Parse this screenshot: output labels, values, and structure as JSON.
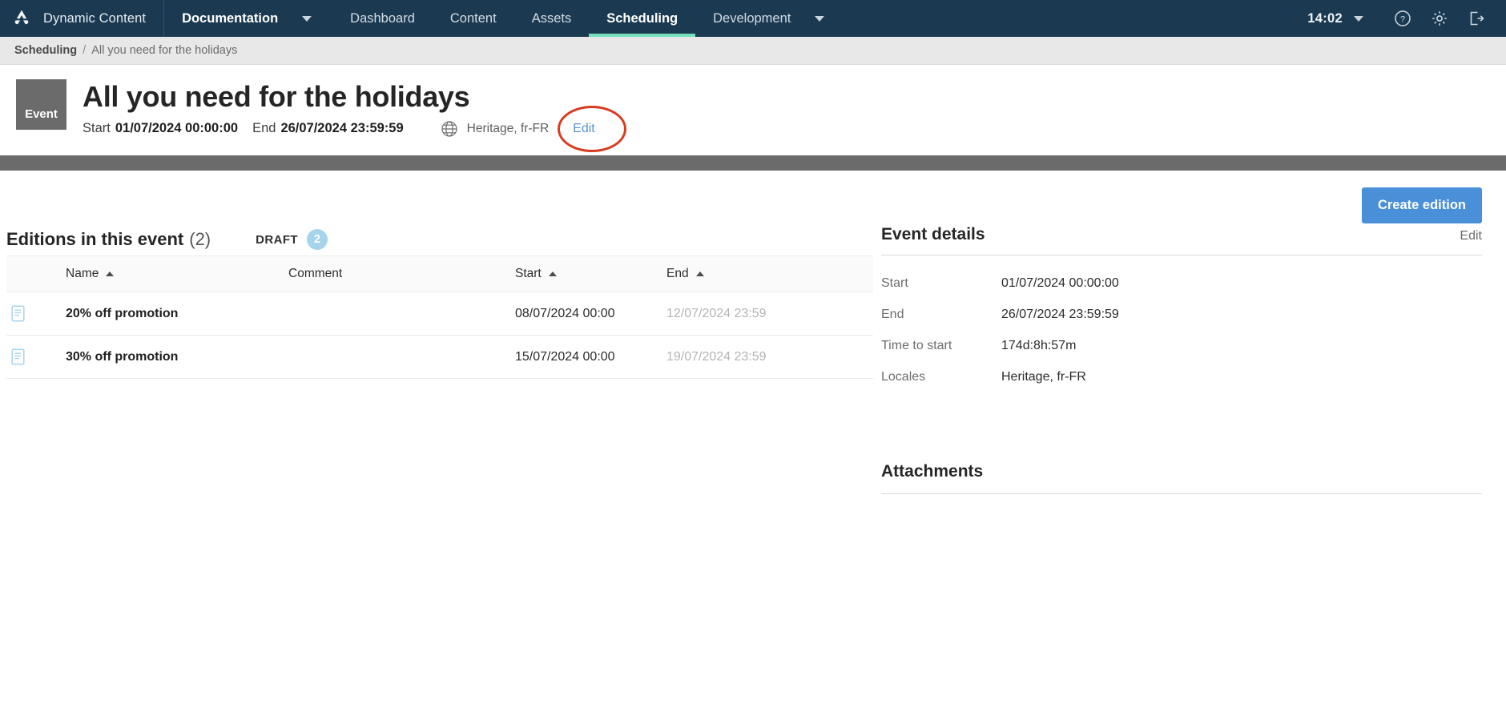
{
  "topnav": {
    "logo_icon": "amplience-logo-icon",
    "brand": "Dynamic Content",
    "items": [
      {
        "label": "Documentation",
        "icon": "chevron-down-icon",
        "has_caret": true,
        "bold": true,
        "active": false
      },
      {
        "label": "Dashboard",
        "has_caret": false,
        "bold": false,
        "active": false
      },
      {
        "label": "Content",
        "has_caret": false,
        "bold": false,
        "active": false
      },
      {
        "label": "Assets",
        "has_caret": false,
        "bold": false,
        "active": false
      },
      {
        "label": "Scheduling",
        "has_caret": false,
        "bold": true,
        "active": true
      },
      {
        "label": "Development",
        "icon": "chevron-down-icon",
        "has_caret": true,
        "bold": false,
        "active": false
      }
    ],
    "clock": "14:02",
    "clock_caret_icon": "chevron-down-icon",
    "help_icon": "help-circle-icon",
    "settings_icon": "gear-icon",
    "logout_icon": "logout-icon",
    "bg_color": "#1b3a52",
    "active_underline_color": "#76e0bd"
  },
  "breadcrumb": {
    "root": "Scheduling",
    "separator": "/",
    "current": "All you need for the holidays"
  },
  "header": {
    "badge": "Event",
    "title": "All you need for the holidays",
    "start_label": "Start",
    "start_value": "01/07/2024 00:00:00",
    "end_label": "End",
    "end_value": "26/07/2024 23:59:59",
    "globe_icon": "globe-icon",
    "locales": "Heritage, fr-FR",
    "edit_label": "Edit",
    "edit_link_color": "#5794d0",
    "annotation_color": "#d83b1e"
  },
  "toolbar": {
    "create_edition_label": "Create edition",
    "primary_color": "#4a90d9"
  },
  "editions": {
    "title": "Editions in this event",
    "count": "(2)",
    "status_label": "DRAFT",
    "status_count": "2",
    "status_pill_color": "#a6d4ec",
    "columns": [
      {
        "label": "",
        "sortable": false
      },
      {
        "label": "Name",
        "sortable": true,
        "sort_icon": "sort-ascending-icon"
      },
      {
        "label": "Comment",
        "sortable": false
      },
      {
        "label": "Start",
        "sortable": true,
        "sort_icon": "sort-ascending-icon"
      },
      {
        "label": "End",
        "sortable": true,
        "sort_icon": "sort-ascending-icon"
      }
    ],
    "rows": [
      {
        "icon": "edition-document-icon",
        "name": "20% off promotion",
        "comment": "",
        "start": "08/07/2024 00:00",
        "end": "12/07/2024 23:59"
      },
      {
        "icon": "edition-document-icon",
        "name": "30% off promotion",
        "comment": "",
        "start": "15/07/2024 00:00",
        "end": "19/07/2024 23:59"
      }
    ]
  },
  "event_details": {
    "title": "Event details",
    "edit_label": "Edit",
    "rows": [
      {
        "key": "Start",
        "value": "01/07/2024 00:00:00"
      },
      {
        "key": "End",
        "value": "26/07/2024 23:59:59"
      },
      {
        "key": "Time to start",
        "value": "174d:8h:57m"
      },
      {
        "key": "Locales",
        "value": "Heritage, fr-FR"
      }
    ]
  },
  "attachments": {
    "title": "Attachments"
  }
}
